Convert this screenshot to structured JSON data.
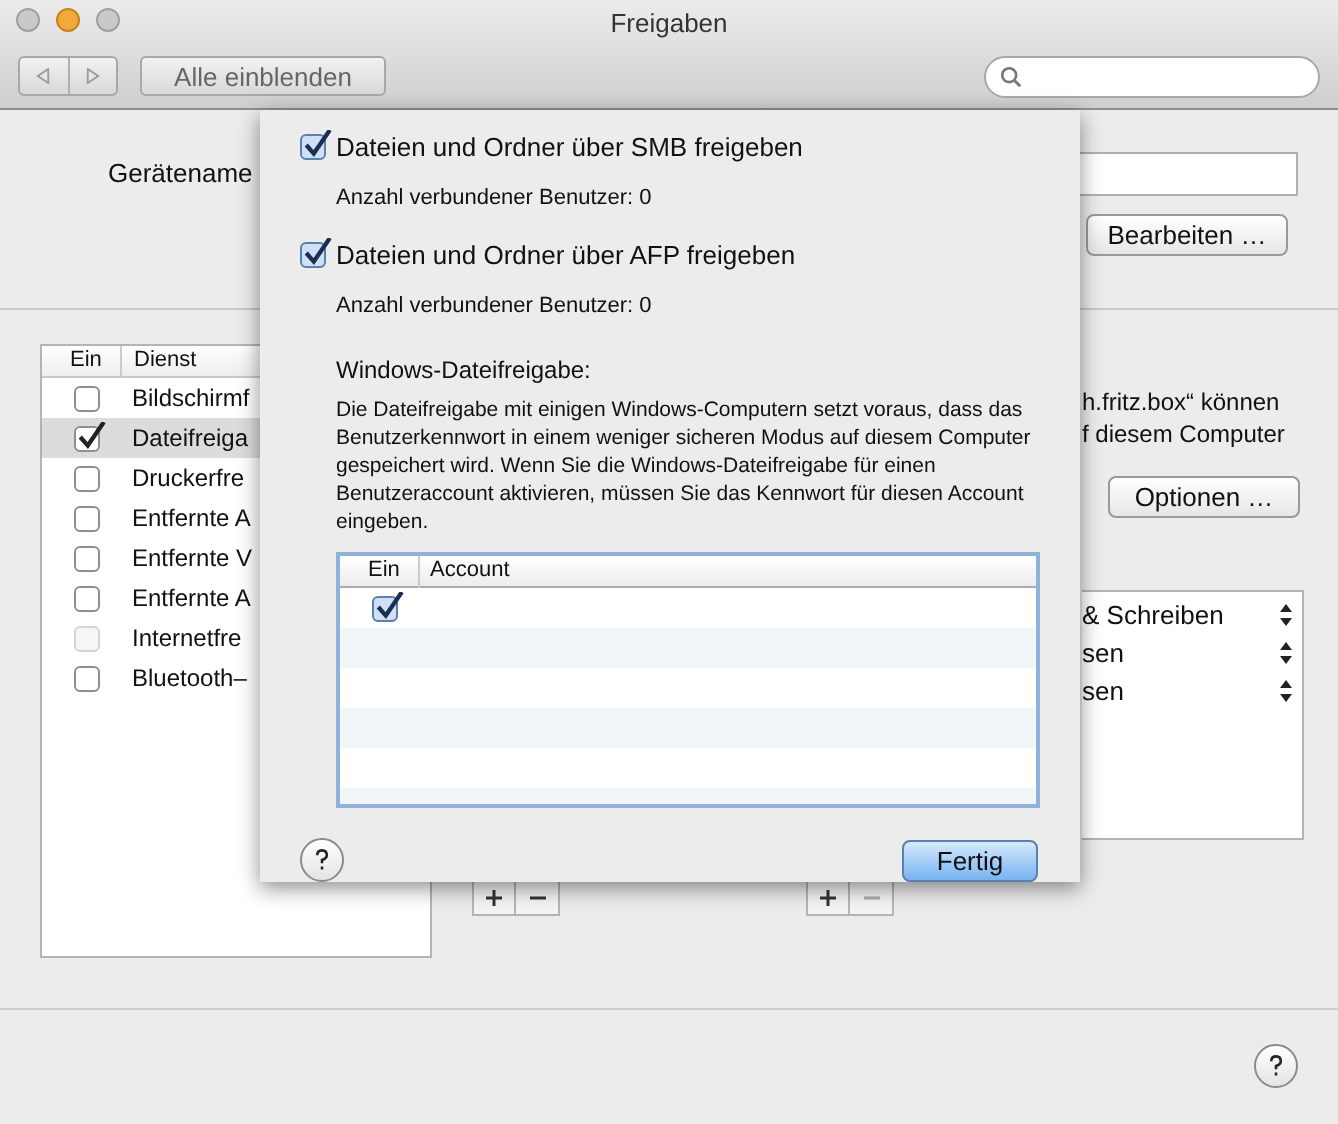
{
  "window": {
    "title": "Freigaben"
  },
  "toolbar": {
    "show_all_button": "Alle einblenden"
  },
  "device": {
    "label": "Gerätename",
    "edit_button": "Bearbeiten …"
  },
  "services": {
    "columns": [
      "Ein",
      "Dienst"
    ],
    "items": [
      {
        "name": "Bildschirmf",
        "checked": false,
        "selected": false,
        "disabled": false
      },
      {
        "name": "Dateifreiga",
        "checked": true,
        "selected": true,
        "disabled": false
      },
      {
        "name": "Druckerfre",
        "checked": false,
        "selected": false,
        "disabled": false
      },
      {
        "name": "Entfernte A",
        "checked": false,
        "selected": false,
        "disabled": false
      },
      {
        "name": "Entfernte V",
        "checked": false,
        "selected": false,
        "disabled": false
      },
      {
        "name": "Entfernte A",
        "checked": false,
        "selected": false,
        "disabled": false
      },
      {
        "name": "Internetfre",
        "checked": false,
        "selected": false,
        "disabled": true
      },
      {
        "name": "Bluetooth–",
        "checked": false,
        "selected": false,
        "disabled": false
      }
    ]
  },
  "address_text": [
    "h.fritz.box“ können",
    "f diesem Computer"
  ],
  "options_button": "Optionen …",
  "permissions": [
    "& Schreiben",
    "sen",
    "sen"
  ],
  "sheet": {
    "protocols": [
      {
        "label": "Dateien und Ordner über SMB freigeben",
        "checked": true,
        "users": "Anzahl verbundener Benutzer: 0"
      },
      {
        "label": "Dateien und Ordner über AFP freigeben",
        "checked": true,
        "users": "Anzahl verbundener Benutzer: 0"
      }
    ],
    "windows_heading": "Windows-Dateifreigabe:",
    "windows_text": "Die Dateifreigabe mit einigen Windows-Computern setzt voraus, dass das Benutzerkennwort in einem weniger sicheren Modus auf diesem Computer gespeichert wird. Wenn Sie die Windows-Dateifreigabe für einen Benutzeraccount aktivieren, müssen Sie das Kennwort für diesen Account eingeben.",
    "account_columns": [
      "Ein",
      "Account"
    ],
    "accounts": [
      {
        "enabled": true
      }
    ],
    "done_button": "Fertig"
  }
}
